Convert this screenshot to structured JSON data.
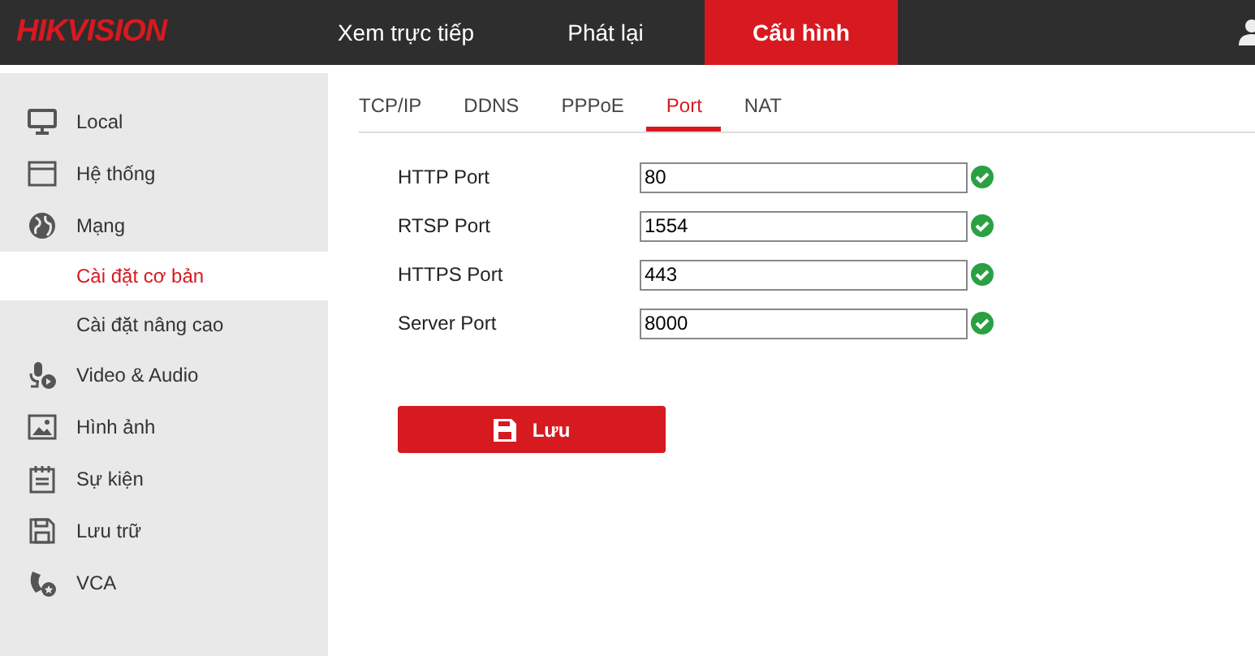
{
  "header": {
    "logo": "HIKVISION",
    "nav": [
      {
        "label": "Xem trực tiếp",
        "selected": false
      },
      {
        "label": "Phát lại",
        "selected": false
      },
      {
        "label": "Cấu hình",
        "selected": true
      }
    ]
  },
  "sidebar": {
    "items": [
      {
        "label": "Local",
        "selected": false
      },
      {
        "label": "Hệ thống",
        "selected": false
      },
      {
        "label": "Mạng",
        "selected": false,
        "children": [
          {
            "label": "Cài đặt cơ bản",
            "selected": true
          },
          {
            "label": "Cài đặt nâng cao",
            "selected": false
          }
        ]
      },
      {
        "label": "Video & Audio",
        "selected": false
      },
      {
        "label": "Hình ảnh",
        "selected": false
      },
      {
        "label": "Sự kiện",
        "selected": false
      },
      {
        "label": "Lưu trữ",
        "selected": false
      },
      {
        "label": "VCA",
        "selected": false
      }
    ]
  },
  "tabs": [
    {
      "label": "TCP/IP",
      "selected": false
    },
    {
      "label": "DDNS",
      "selected": false
    },
    {
      "label": "PPPoE",
      "selected": false
    },
    {
      "label": "Port",
      "selected": true
    },
    {
      "label": "NAT",
      "selected": false
    }
  ],
  "fields": [
    {
      "label": "HTTP Port",
      "value": "80",
      "valid": true
    },
    {
      "label": "RTSP Port",
      "value": "1554",
      "valid": true
    },
    {
      "label": "HTTPS Port",
      "value": "443",
      "valid": true
    },
    {
      "label": "Server Port",
      "value": "8000",
      "valid": true
    }
  ],
  "save_button": "Lưu"
}
